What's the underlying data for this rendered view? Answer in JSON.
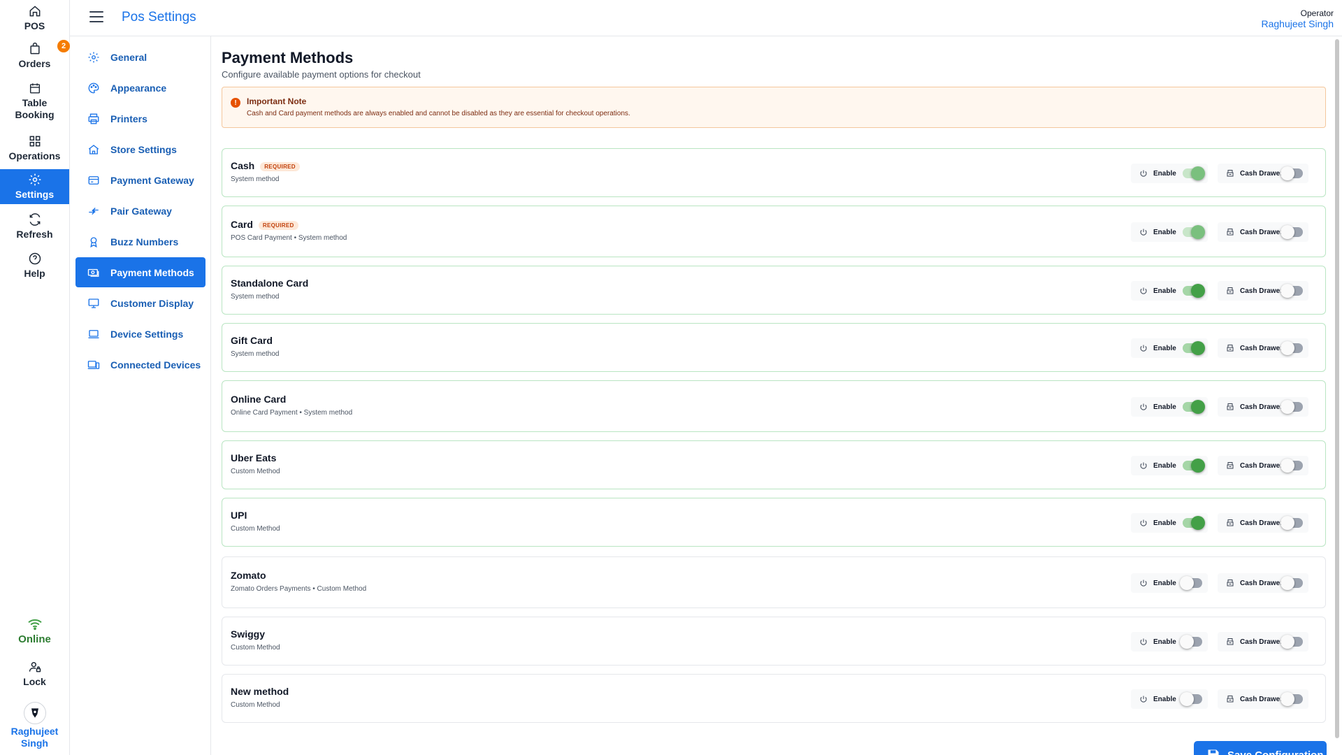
{
  "rail": {
    "items": [
      {
        "label": "POS",
        "icon": "home-icon"
      },
      {
        "label": "Orders",
        "icon": "bag-icon",
        "badge": "2"
      },
      {
        "label": "Table Booking",
        "icon": "calendar-icon"
      },
      {
        "label": "Operations",
        "icon": "grid-icon"
      },
      {
        "label": "Settings",
        "icon": "gear-icon"
      },
      {
        "label": "Refresh",
        "icon": "refresh-icon"
      },
      {
        "label": "Help",
        "icon": "help-icon"
      }
    ],
    "status": "Online",
    "lock": "Lock",
    "user": "Raghujeet Singh"
  },
  "topbar": {
    "title": "Pos Settings",
    "operator_label": "Operator",
    "operator_name": "Raghujeet Singh"
  },
  "subnav": {
    "items": [
      {
        "label": "General",
        "icon": "gear-icon"
      },
      {
        "label": "Appearance",
        "icon": "palette-icon"
      },
      {
        "label": "Printers",
        "icon": "printer-icon"
      },
      {
        "label": "Store Settings",
        "icon": "store-icon"
      },
      {
        "label": "Payment Gateway",
        "icon": "credit-card-icon"
      },
      {
        "label": "Pair Gateway",
        "icon": "pair-arrows-icon"
      },
      {
        "label": "Buzz Numbers",
        "icon": "badge-icon"
      },
      {
        "label": "Payment Methods",
        "icon": "money-icon"
      },
      {
        "label": "Customer Display",
        "icon": "monitor-icon"
      },
      {
        "label": "Device Settings",
        "icon": "laptop-icon"
      },
      {
        "label": "Connected Devices",
        "icon": "devices-icon"
      }
    ],
    "active": "Payment Methods"
  },
  "main": {
    "title": "Payment Methods",
    "subtitle": "Configure available payment options for checkout",
    "note": {
      "title": "Important Note",
      "text": "Cash and Card payment methods are always enabled and cannot be disabled as they are essential for checkout operations."
    },
    "enable_label": "Enable",
    "drawer_label": "Cash Drawer",
    "required_label": "REQUIRED",
    "methods": [
      {
        "name": "Cash",
        "required": true,
        "sub": "System method",
        "enabled": true,
        "drawer": false
      },
      {
        "name": "Card",
        "required": true,
        "sub": "POS Card Payment • System method",
        "enabled": true,
        "drawer": false
      },
      {
        "name": "Standalone Card",
        "required": false,
        "sub": "System method",
        "enabled": true,
        "drawer": false
      },
      {
        "name": "Gift Card",
        "required": false,
        "sub": "System method",
        "enabled": true,
        "drawer": false
      },
      {
        "name": "Online Card",
        "required": false,
        "sub": "Online Card Payment • System method",
        "enabled": true,
        "drawer": false
      },
      {
        "name": "Uber Eats",
        "required": false,
        "sub": "Custom Method",
        "enabled": true,
        "drawer": false
      },
      {
        "name": "UPI",
        "required": false,
        "sub": "Custom Method",
        "enabled": true,
        "drawer": false
      },
      {
        "name": "Zomato",
        "required": false,
        "sub": "Zomato Orders Payments • Custom Method",
        "enabled": false,
        "drawer": false
      },
      {
        "name": "Swiggy",
        "required": false,
        "sub": "Custom Method",
        "enabled": false,
        "drawer": false
      },
      {
        "name": "New method",
        "required": false,
        "sub": "Custom Method",
        "enabled": false,
        "drawer": false
      }
    ],
    "save_label": "Save Configuration"
  },
  "colors": {
    "accent": "#1a73e8",
    "toggle_on": "#43a047",
    "note_bg": "#fff7ef",
    "badge": "#f57c00"
  }
}
